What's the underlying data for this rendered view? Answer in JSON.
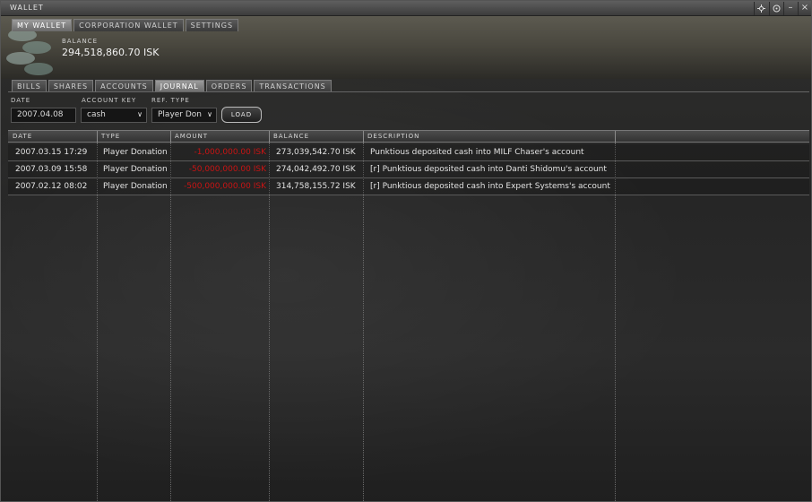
{
  "window": {
    "title": "WALLET",
    "controls": [
      "gear-icon",
      "target-icon",
      "minimize-icon",
      "close-icon"
    ]
  },
  "top_tabs": [
    {
      "label": "MY WALLET",
      "active": true
    },
    {
      "label": "CORPORATION WALLET",
      "active": false
    },
    {
      "label": "SETTINGS",
      "active": false
    }
  ],
  "balance": {
    "label": "BALANCE",
    "value": "294,518,860.70 ISK"
  },
  "sub_tabs": [
    {
      "label": "BILLS",
      "active": false
    },
    {
      "label": "SHARES",
      "active": false
    },
    {
      "label": "ACCOUNTS",
      "active": false
    },
    {
      "label": "JOURNAL",
      "active": true
    },
    {
      "label": "ORDERS",
      "active": false
    },
    {
      "label": "TRANSACTIONS",
      "active": false
    }
  ],
  "filters": {
    "date_label": "DATE",
    "date_value": "2007.04.08",
    "account_key_label": "ACCOUNT KEY",
    "account_key_value": "cash",
    "ref_type_label": "REF. TYPE",
    "ref_type_value": "Player Don",
    "load_label": "LOAD"
  },
  "journal": {
    "columns": [
      "DATE",
      "TYPE",
      "AMOUNT",
      "BALANCE",
      "DESCRIPTION"
    ],
    "rows": [
      {
        "date": "2007.03.15 17:29",
        "type": "Player Donation",
        "amount": "-1,000,000.00 ISK",
        "balance": "273,039,542.70 ISK",
        "description": "Punktious deposited cash into MILF Chaser's account"
      },
      {
        "date": "2007.03.09 15:58",
        "type": "Player Donation",
        "amount": "-50,000,000.00 ISK",
        "balance": "274,042,492.70 ISK",
        "description": "[r] Punktious deposited cash into Danti Shidomu's account"
      },
      {
        "date": "2007.02.12 08:02",
        "type": "Player Donation",
        "amount": "-500,000,000.00 ISK",
        "balance": "314,758,155.72 ISK",
        "description": "[r] Punktious deposited cash into Expert Systems's account"
      }
    ]
  },
  "colors": {
    "negative_amount": "#c81414",
    "active_tab": "#8a8a8a"
  }
}
